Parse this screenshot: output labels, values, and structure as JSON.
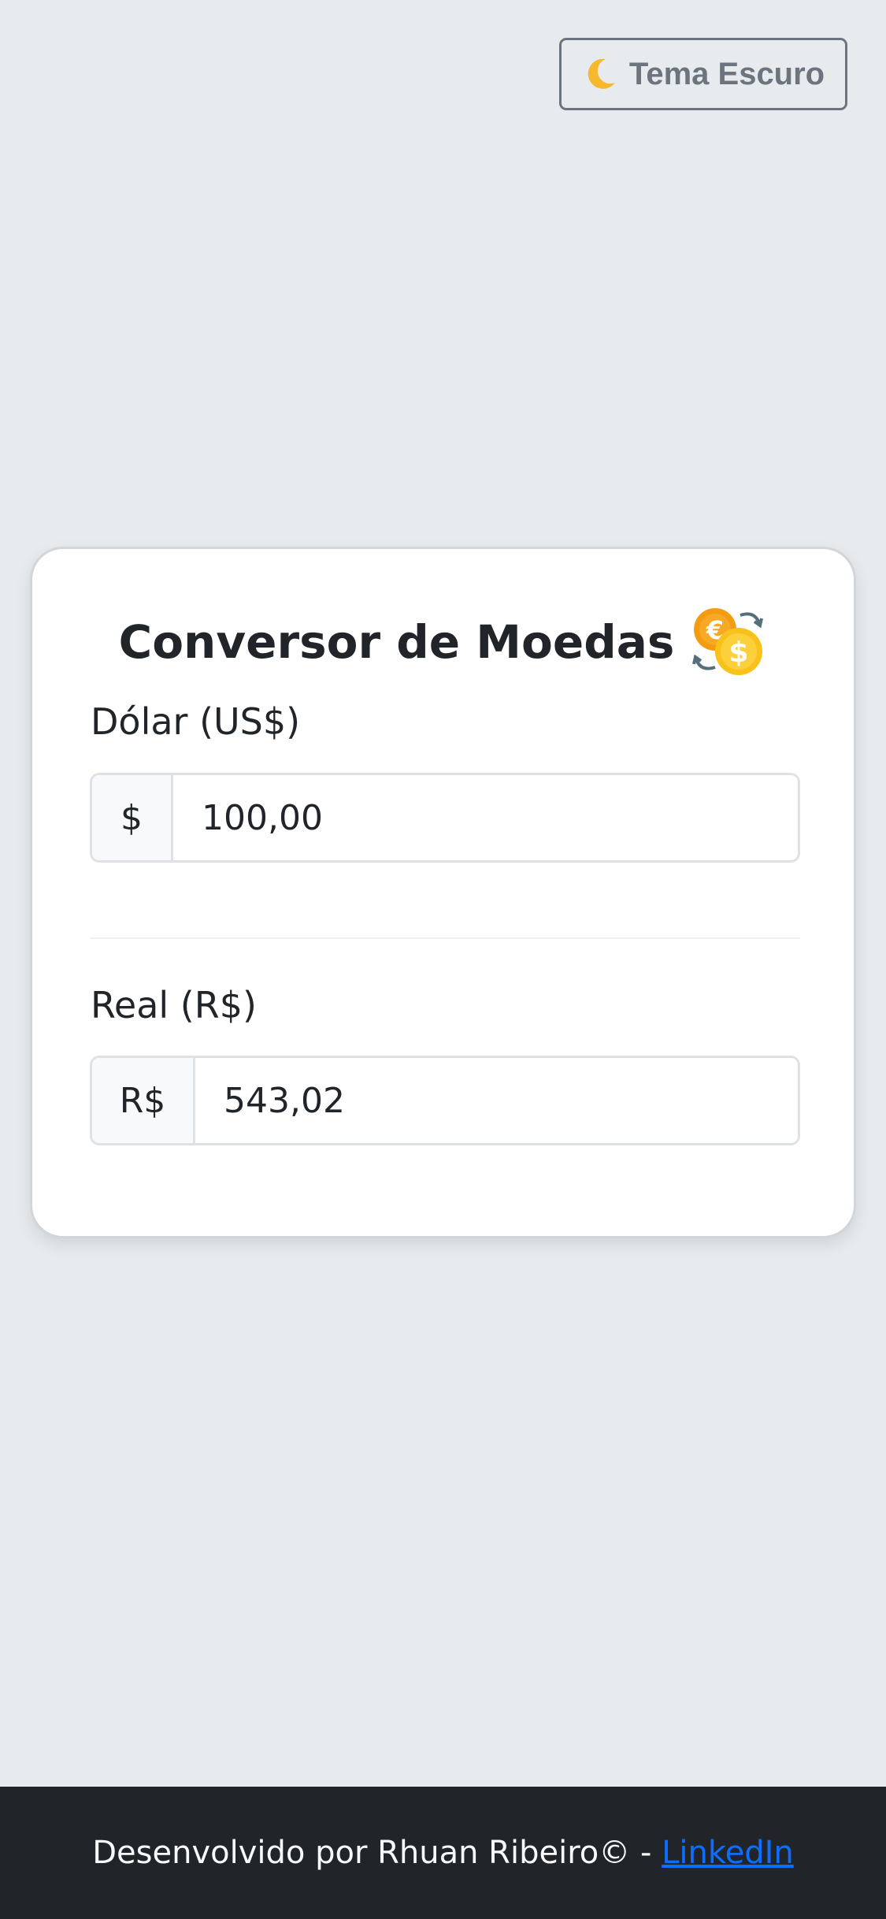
{
  "theme_toggle": {
    "label": "Tema Escuro",
    "icon": "moon-icon"
  },
  "converter": {
    "title": "Conversor de Moedas",
    "title_icon": "currency-exchange-coins-icon",
    "dollar": {
      "label": "Dólar (US$)",
      "prefix": "$",
      "value": "100,00"
    },
    "real": {
      "label": "Real (R$)",
      "prefix": "R$",
      "value": "543,02"
    }
  },
  "footer": {
    "text": "Desenvolvido por Rhuan Ribeiro© - ",
    "link_label": "LinkedIn"
  },
  "colors": {
    "page_background": "#e8ebee",
    "card_background": "#ffffff",
    "text": "#212529",
    "muted": "#6c757d",
    "footer_background": "#212529",
    "link": "#0d6efd"
  }
}
